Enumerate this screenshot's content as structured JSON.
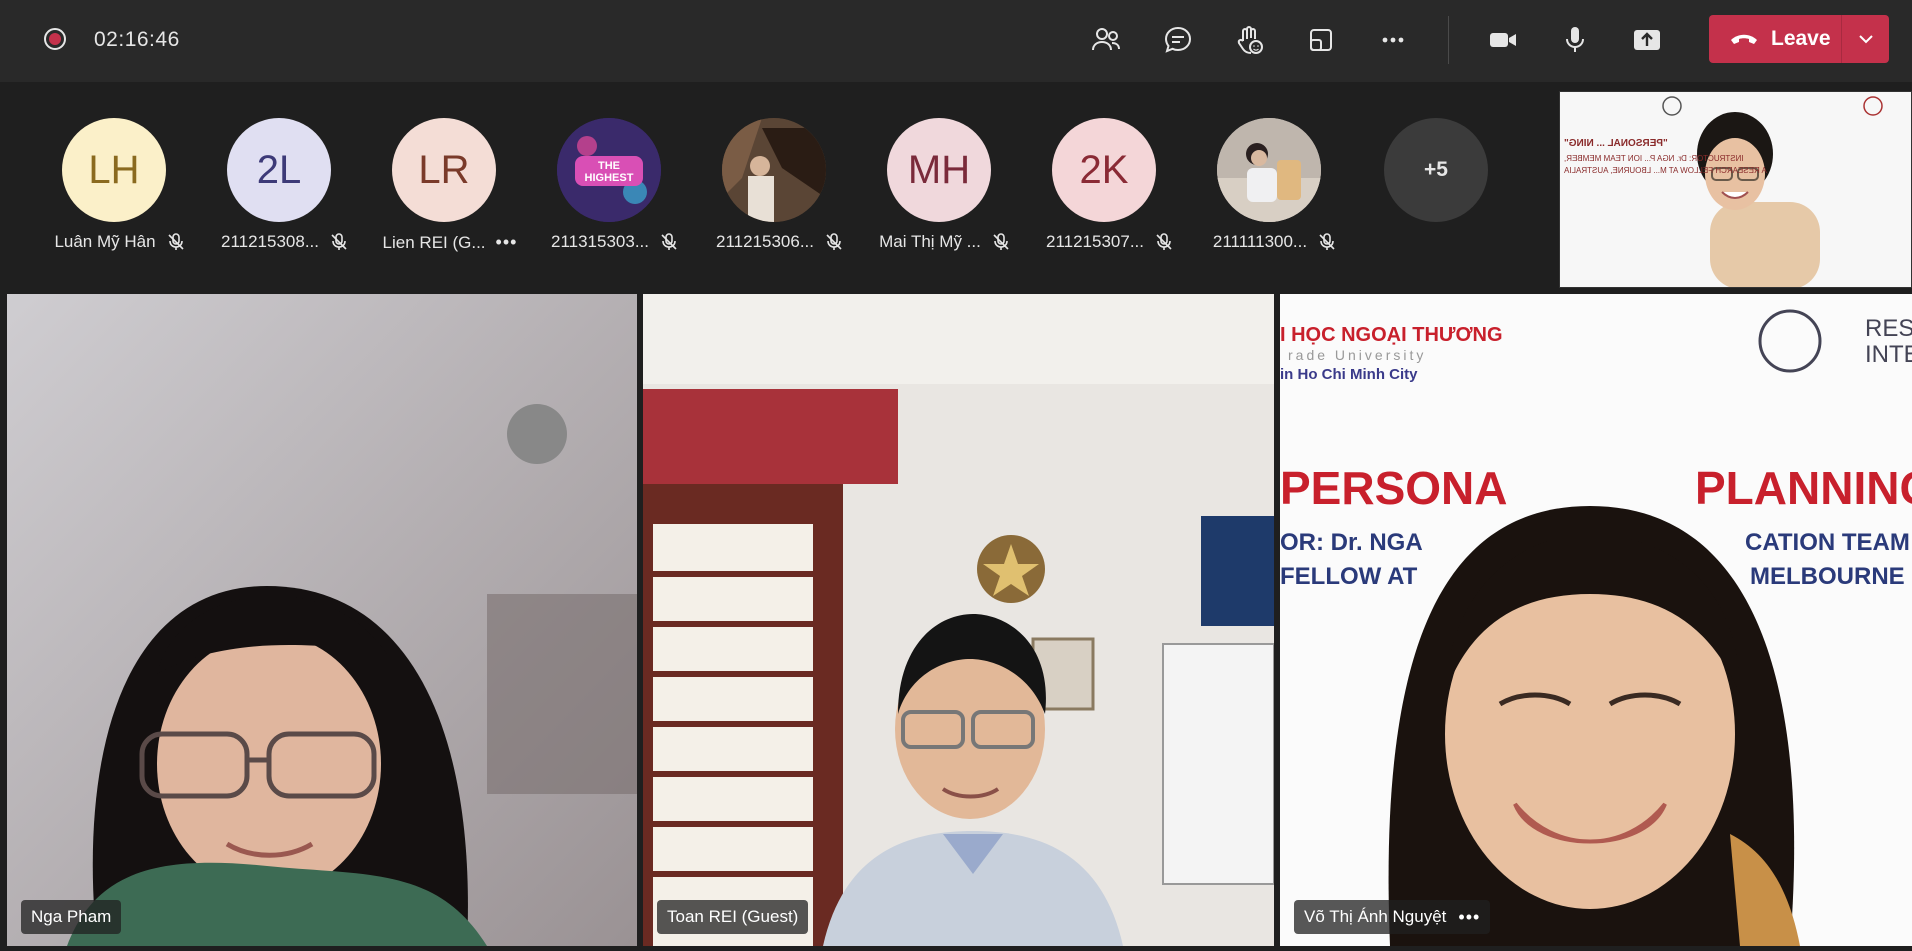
{
  "meeting": {
    "timer": "02:16:46",
    "leave_label": "Leave"
  },
  "toolbar": {
    "icons": [
      "people-icon",
      "chat-icon",
      "raise-hand-icon",
      "breakout-icon",
      "more-options-icon",
      "camera-icon",
      "microphone-icon",
      "share-icon"
    ]
  },
  "participants": [
    {
      "initials": "LH",
      "name": "Luân Mỹ Hân",
      "bg": "#fbf0c9",
      "fg": "#8a6a1f",
      "status": "mic-off"
    },
    {
      "initials": "2L",
      "name": "211215308...",
      "bg": "#e0dff2",
      "fg": "#3d3a78",
      "status": "mic-off"
    },
    {
      "initials": "LR",
      "name": "Lien REI (G...",
      "bg": "#f4ddd6",
      "fg": "#7a3a2a",
      "status": "more"
    },
    {
      "initials": "",
      "name": "211315303...",
      "bg": "#3a2a6b",
      "fg": "#ffffff",
      "status": "mic-off",
      "image": "the-highest-logo"
    },
    {
      "initials": "",
      "name": "211215306...",
      "bg": "#4a3a30",
      "fg": "#ffffff",
      "status": "mic-off",
      "image": "photo"
    },
    {
      "initials": "MH",
      "name": "Mai Thị Mỹ ...",
      "bg": "#f0d8dc",
      "fg": "#7a2a3a",
      "status": "mic-off"
    },
    {
      "initials": "2K",
      "name": "211215307...",
      "bg": "#f4d6d8",
      "fg": "#8a2a35",
      "status": "mic-off"
    },
    {
      "initials": "",
      "name": "211111300...",
      "bg": "#c9c0b8",
      "fg": "#ffffff",
      "status": "mic-off",
      "image": "photo"
    }
  ],
  "overflow_count": "+5",
  "logo_text": "THE HIGHEST",
  "share": {
    "line1": "\"PERSONAL ... NING\"",
    "line2": "INSTRUCTOR: Dr. NGA P... ION TEAM MEMBER,",
    "line3": "A RESEARCH FELLOW AT M... LBOURNE, AUSTRALIA"
  },
  "tiles": [
    {
      "name": "Nga Pham",
      "has_more": false
    },
    {
      "name": "Toan REI (Guest)",
      "has_more": false
    },
    {
      "name": "Võ Thị Ánh Nguyệt",
      "has_more": true
    }
  ],
  "slide": {
    "uni_line1": "I HỌC NGOẠI THƯƠNG",
    "uni_line2": "rade University",
    "uni_line3": "in Ho Chi Minh City",
    "logo_text": "RESO\nINTE",
    "title_left": "PERSONA",
    "title_right": "PLANNING",
    "instr_left": "OR: Dr. NGA",
    "instr_right": "CATION TEAM",
    "fellow_left": "FELLOW AT",
    "fellow_right": "MELBOURNE"
  }
}
